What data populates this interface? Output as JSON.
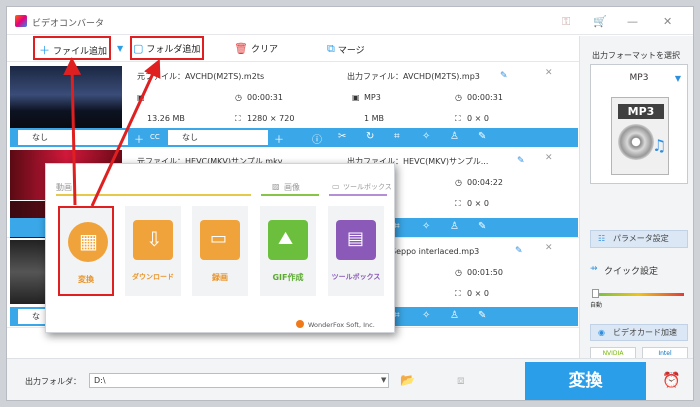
{
  "app": {
    "title": "ビデオコンバータ"
  },
  "toolbar": {
    "add_file": "ファイル追加",
    "add_folder": "フォルダ追加",
    "clear": "クリア",
    "merge": "マージ"
  },
  "files": [
    {
      "src_label": "元ファイル：AVCHD(M2TS).m2ts",
      "src_duration": "00:00:31",
      "src_size": "13.26 MB",
      "src_res": "1280 × 720",
      "out_label": "出力ファイル：AVCHD(M2TS).mp3",
      "out_format": "MP3",
      "out_duration": "00:00:31",
      "out_size": "1 MB",
      "out_res": "0 × 0",
      "subtitle": "なし",
      "audio": "なし"
    },
    {
      "src_label": "元ファイル：HEVC(MKV)サンプル.mkv",
      "out_label": "出力ファイル：HEVC(MKV)サンプル...",
      "out_duration": "00:04:22",
      "out_res": "0 × 0"
    },
    {
      "out_label": "イル：Seppo interlaced.mp3",
      "out_duration": "00:01:50",
      "out_res": "0 × 0",
      "subtitle_short": "な"
    }
  ],
  "right_panel": {
    "title": "出力フォーマットを選択",
    "format": "MP3",
    "format_icon_text": "MP3",
    "param_button": "パラメータ設定",
    "quick_setting": "クイック設定",
    "auto_label": "自動",
    "gpu_button": "ビデオカード加速",
    "gpu_vendors": [
      "NVIDIA",
      "Intel"
    ]
  },
  "bottom": {
    "output_folder_label": "出力フォルダ：",
    "output_folder_value": "D:\\",
    "convert_button": "変換"
  },
  "popup": {
    "categories": {
      "video": "動画",
      "image": "画像",
      "toolbox": "ツールボックス"
    },
    "tiles": [
      {
        "label": "変換",
        "color": "#f0a33a"
      },
      {
        "label": "ダウンロード",
        "color": "#f0a33a"
      },
      {
        "label": "録画",
        "color": "#f0a33a"
      },
      {
        "label": "GIF作成",
        "color": "#6cbf3c"
      },
      {
        "label": "ツールボックス",
        "color": "#8b5ab8"
      }
    ],
    "watermark": "WonderFox Soft, Inc."
  },
  "colors": {
    "accent": "#2a9ee8",
    "highlight": "#e02020"
  }
}
